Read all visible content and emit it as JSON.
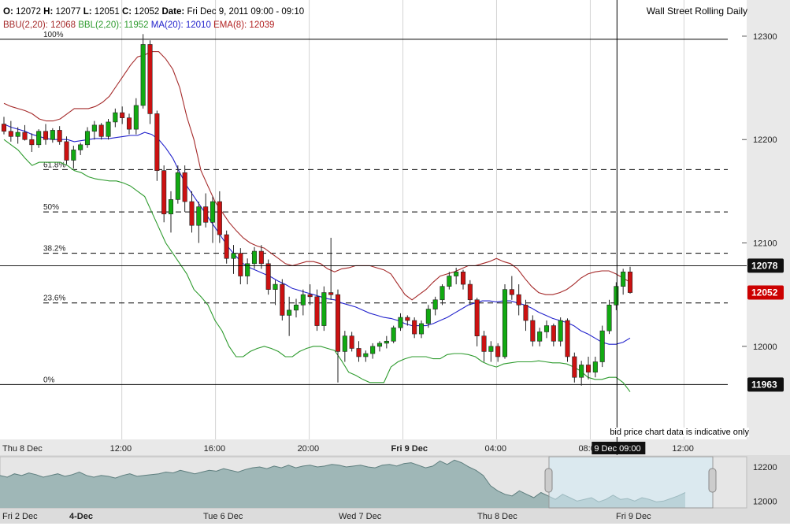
{
  "header": {
    "ohlc": [
      {
        "label": "O:",
        "value": "12072"
      },
      {
        "label": "H:",
        "value": "12077"
      },
      {
        "label": "L:",
        "value": "12051"
      },
      {
        "label": "C:",
        "value": "12052"
      }
    ],
    "date_label": "Date:",
    "date_value": "Fri Dec 9, 2011 09:00 - 09:10",
    "title": "Wall Street Rolling Daily",
    "indicators": [
      {
        "label": "BBU(2,20):",
        "value": "12068",
        "color": "#a52a2a"
      },
      {
        "label": "BBL(2,20):",
        "value": "11952",
        "color": "#2e9b2e"
      },
      {
        "label": "MA(20):",
        "value": "12010",
        "color": "#2222cc"
      },
      {
        "label": "EMA(8):",
        "value": "12039",
        "color": "#b22222"
      }
    ]
  },
  "footnote": "bid price chart data is indicative only",
  "crosshair": {
    "time_label": "9 Dec 09:00",
    "price_label": "12078",
    "price": 12078
  },
  "last_price": {
    "label": "12052",
    "price": 12052,
    "color": "#cc0000"
  },
  "low_marker": {
    "label": "11963",
    "price": 11963
  },
  "colors": {
    "up": "#11aa11",
    "down": "#cc1111",
    "bbu": "#a52a2a",
    "bbl": "#2e9b2e",
    "ma": "#2222cc",
    "ema": "#b22222"
  },
  "chart_data": {
    "type": "candlestick",
    "y_axis": {
      "min": 11910,
      "max": 12335,
      "ticks": [
        12000,
        12100,
        12200,
        12300
      ]
    },
    "x_axis": {
      "start_hour": 6.8,
      "end_hour": 33.7,
      "ticks": [
        {
          "label": "Thu 8 Dec",
          "hour": 6.8,
          "bold": false
        },
        {
          "label": "12:00",
          "hour": 12,
          "bold": false
        },
        {
          "label": "16:00",
          "hour": 16,
          "bold": false
        },
        {
          "label": "20:00",
          "hour": 20,
          "bold": false
        },
        {
          "label": "Fri 9 Dec",
          "hour": 24,
          "bold": true
        },
        {
          "label": "04:00",
          "hour": 28,
          "bold": false
        },
        {
          "label": "08:00",
          "hour": 32,
          "bold": false
        },
        {
          "label": "12:00",
          "hour": 36,
          "bold": false
        }
      ]
    },
    "fibonacci": [
      {
        "label": "100%",
        "price": 12297
      },
      {
        "label": "61.8%",
        "price": 12171
      },
      {
        "label": "50%",
        "price": 12130
      },
      {
        "label": "38.2%",
        "price": 12090
      },
      {
        "label": "23.6%",
        "price": 12042
      },
      {
        "label": "0%",
        "price": 11963
      }
    ],
    "candles": [
      [
        12215,
        12222,
        12205,
        12208
      ],
      [
        12208,
        12218,
        12198,
        12203
      ],
      [
        12203,
        12212,
        12196,
        12207
      ],
      [
        12207,
        12214,
        12199,
        12200
      ],
      [
        12200,
        12206,
        12188,
        12195
      ],
      [
        12195,
        12210,
        12192,
        12208
      ],
      [
        12208,
        12215,
        12195,
        12200
      ],
      [
        12200,
        12211,
        12197,
        12209
      ],
      [
        12209,
        12213,
        12195,
        12198
      ],
      [
        12198,
        12203,
        12176,
        12180
      ],
      [
        12180,
        12194,
        12172,
        12190
      ],
      [
        12190,
        12197,
        12185,
        12195
      ],
      [
        12195,
        12212,
        12192,
        12208
      ],
      [
        12208,
        12218,
        12200,
        12214
      ],
      [
        12214,
        12216,
        12200,
        12203
      ],
      [
        12203,
        12220,
        12200,
        12217
      ],
      [
        12217,
        12230,
        12212,
        12226
      ],
      [
        12226,
        12232,
        12215,
        12221
      ],
      [
        12221,
        12225,
        12205,
        12210
      ],
      [
        12210,
        12240,
        12205,
        12233
      ],
      [
        12233,
        12302,
        12230,
        12292
      ],
      [
        12292,
        12296,
        12215,
        12225
      ],
      [
        12225,
        12228,
        12160,
        12170
      ],
      [
        12170,
        12175,
        12120,
        12128
      ],
      [
        12128,
        12150,
        12110,
        12142
      ],
      [
        12142,
        12175,
        12138,
        12168
      ],
      [
        12168,
        12175,
        12130,
        12140
      ],
      [
        12140,
        12150,
        12110,
        12117
      ],
      [
        12117,
        12140,
        12100,
        12135
      ],
      [
        12135,
        12148,
        12115,
        12120
      ],
      [
        12120,
        12145,
        12100,
        12140
      ],
      [
        12140,
        12150,
        12100,
        12108
      ],
      [
        12108,
        12112,
        12080,
        12085
      ],
      [
        12085,
        12098,
        12070,
        12090
      ],
      [
        12090,
        12095,
        12060,
        12068
      ],
      [
        12068,
        12085,
        12060,
        12080
      ],
      [
        12080,
        12096,
        12075,
        12092
      ],
      [
        12092,
        12098,
        12075,
        12080
      ],
      [
        12080,
        12084,
        12050,
        12055
      ],
      [
        12055,
        12064,
        12040,
        12060
      ],
      [
        12060,
        12065,
        12025,
        12030
      ],
      [
        12030,
        12048,
        12010,
        12035
      ],
      [
        12035,
        12046,
        12028,
        12040
      ],
      [
        12040,
        12055,
        12030,
        12050
      ],
      [
        12050,
        12060,
        12040,
        12048
      ],
      [
        12048,
        12055,
        12015,
        12020
      ],
      [
        12020,
        12058,
        12015,
        12052
      ],
      [
        12052,
        12105,
        12045,
        12050
      ],
      [
        12050,
        12055,
        11965,
        11995
      ],
      [
        11995,
        12015,
        11985,
        12010
      ],
      [
        12010,
        12014,
        11995,
        11998
      ],
      [
        11998,
        12005,
        11985,
        11990
      ],
      [
        11990,
        11996,
        11985,
        11993
      ],
      [
        11993,
        12003,
        11988,
        12000
      ],
      [
        12000,
        12005,
        11995,
        12003
      ],
      [
        12003,
        12010,
        11998,
        12005
      ],
      [
        12005,
        12020,
        12003,
        12018
      ],
      [
        12018,
        12032,
        12015,
        12028
      ],
      [
        12028,
        12030,
        12020,
        12025
      ],
      [
        12025,
        12028,
        12008,
        12012
      ],
      [
        12012,
        12025,
        12008,
        12022
      ],
      [
        12022,
        12040,
        12018,
        12036
      ],
      [
        12036,
        12048,
        12030,
        12045
      ],
      [
        12045,
        12060,
        12040,
        12058
      ],
      [
        12058,
        12072,
        12055,
        12068
      ],
      [
        12068,
        12076,
        12060,
        12072
      ],
      [
        12072,
        12074,
        12055,
        12060
      ],
      [
        12060,
        12064,
        12040,
        12045
      ],
      [
        12045,
        12047,
        12000,
        12010
      ],
      [
        12010,
        12015,
        11985,
        11995
      ],
      [
        11995,
        12005,
        11985,
        12000
      ],
      [
        12000,
        12003,
        11985,
        11990
      ],
      [
        11990,
        12060,
        11988,
        12055
      ],
      [
        12055,
        12068,
        12045,
        12050
      ],
      [
        12050,
        12060,
        12030,
        12040
      ],
      [
        12040,
        12045,
        12015,
        12025
      ],
      [
        12025,
        12030,
        12000,
        12005
      ],
      [
        12005,
        12018,
        12000,
        12014
      ],
      [
        12014,
        12025,
        12008,
        12020
      ],
      [
        12020,
        12022,
        12000,
        12005
      ],
      [
        12005,
        12028,
        12000,
        12025
      ],
      [
        12025,
        12027,
        11985,
        11990
      ],
      [
        11990,
        11994,
        11965,
        11970
      ],
      [
        11970,
        11986,
        11962,
        11982
      ],
      [
        11982,
        11990,
        11968,
        11975
      ],
      [
        11975,
        11990,
        11970,
        11985
      ],
      [
        11985,
        12020,
        11980,
        12015
      ],
      [
        12015,
        12045,
        12012,
        12040
      ],
      [
        12040,
        12062,
        12035,
        12058
      ],
      [
        12058,
        12075,
        12050,
        12072
      ],
      [
        12072,
        12077,
        12051,
        12052
      ]
    ],
    "bbu": [
      12235,
      12232,
      12230,
      12228,
      12225,
      12220,
      12218,
      12218,
      12220,
      12225,
      12230,
      12230,
      12230,
      12232,
      12236,
      12242,
      12252,
      12262,
      12272,
      12280,
      12282,
      12285,
      12285,
      12278,
      12268,
      12250,
      12222,
      12200,
      12170,
      12155,
      12140,
      12130,
      12120,
      12112,
      12105,
      12100,
      12097,
      12095,
      12090,
      12085,
      12080,
      12078,
      12080,
      12082,
      12082,
      12080,
      12075,
      12072,
      12075,
      12076,
      12078,
      12078,
      12078,
      12076,
      12074,
      12070,
      12060,
      12050,
      12045,
      12050,
      12055,
      12062,
      12068,
      12070,
      12072,
      12075,
      12078,
      12078,
      12080,
      12082,
      12085,
      12082,
      12080,
      12075,
      12066,
      12058,
      12052,
      12050,
      12050,
      12052,
      12055,
      12060,
      12066,
      12070,
      12072,
      12073,
      12073,
      12070,
      12066,
      12062
    ],
    "ma": [
      12215,
      12212,
      12210,
      12208,
      12205,
      12203,
      12201,
      12200,
      12200,
      12200,
      12198,
      12199,
      12200,
      12201,
      12201,
      12201,
      12202,
      12203,
      12204,
      12204,
      12207,
      12205,
      12200,
      12192,
      12182,
      12168,
      12155,
      12145,
      12135,
      12125,
      12115,
      12105,
      12095,
      12087,
      12080,
      12076,
      12073,
      12070,
      12067,
      12063,
      12060,
      12056,
      12054,
      12052,
      12050,
      12048,
      12046,
      12045,
      12042,
      12040,
      12038,
      12035,
      12032,
      12030,
      12028,
      12027,
      12025,
      12022,
      12020,
      12020,
      12020,
      12022,
      12025,
      12028,
      12032,
      12036,
      12040,
      12042,
      12044,
      12044,
      12043,
      12044,
      12044,
      12042,
      12040,
      12037,
      12033,
      12030,
      12027,
      12025,
      12023,
      12020,
      12015,
      12012,
      12008,
      12004,
      12002,
      12002,
      12004,
      12008
    ],
    "bbl": [
      12200,
      12195,
      12190,
      12182,
      12175,
      12178,
      12178,
      12178,
      12178,
      12175,
      12170,
      12168,
      12164,
      12162,
      12161,
      12160,
      12160,
      12158,
      12155,
      12150,
      12145,
      12130,
      12115,
      12100,
      12090,
      12080,
      12070,
      12055,
      12048,
      12040,
      12025,
      12015,
      12000,
      11990,
      11990,
      11995,
      11998,
      12000,
      11998,
      11995,
      11990,
      11990,
      11995,
      11998,
      12000,
      12000,
      11998,
      11996,
      11986,
      11975,
      11972,
      11968,
      11965,
      11965,
      11965,
      11980,
      11985,
      11988,
      11990,
      11990,
      11990,
      11988,
      11988,
      11992,
      11993,
      11993,
      11992,
      11990,
      11985,
      11982,
      11980,
      11983,
      11984,
      11985,
      11985,
      11985,
      11986,
      11985,
      11984,
      11984,
      11983,
      11980,
      11976,
      11970,
      11968,
      11968,
      11970,
      11970,
      11965,
      11956
    ]
  },
  "overview": {
    "axis_labels": [
      {
        "label": "Fri 2 Dec",
        "bold": false
      },
      {
        "label": "4-Dec",
        "bold": true
      },
      {
        "label": "Tue 6 Dec",
        "bold": false
      },
      {
        "label": "Wed 7 Dec",
        "bold": false
      },
      {
        "label": "Thu 8 Dec",
        "bold": false
      },
      {
        "label": "Fri 9 Dec",
        "bold": false
      }
    ],
    "y_labels": [
      {
        "label": "12200",
        "price": 12200
      },
      {
        "label": "12000",
        "price": 12000
      }
    ],
    "ylim": [
      11960,
      12260
    ],
    "series": [
      12150,
      12140,
      12160,
      12150,
      12165,
      12155,
      12140,
      12150,
      12160,
      12145,
      12155,
      12170,
      12150,
      12140,
      12150,
      12145,
      12135,
      12150,
      12160,
      12145,
      12150,
      12155,
      12160,
      12170,
      12165,
      12180,
      12170,
      12160,
      12170,
      12180,
      12175,
      12190,
      12180,
      12170,
      12185,
      12195,
      12200,
      12190,
      12205,
      12195,
      12210,
      12195,
      12205,
      12210,
      12200,
      12205,
      12215,
      12210,
      12200,
      12205,
      12210,
      12200,
      12195,
      12210,
      12215,
      12205,
      12220,
      12225,
      12210,
      12195,
      12205,
      12235,
      12215,
      12240,
      12225,
      12200,
      12180,
      12150,
      12090,
      12060,
      12040,
      12030,
      12060,
      12040,
      12020,
      12050,
      12030,
      12010,
      12040,
      12020,
      12000,
      12010,
      12020,
      11995,
      12010,
      12035,
      12010,
      12015,
      12000,
      12020,
      12010,
      11995,
      12000,
      12015,
      12030,
      12050
    ]
  }
}
